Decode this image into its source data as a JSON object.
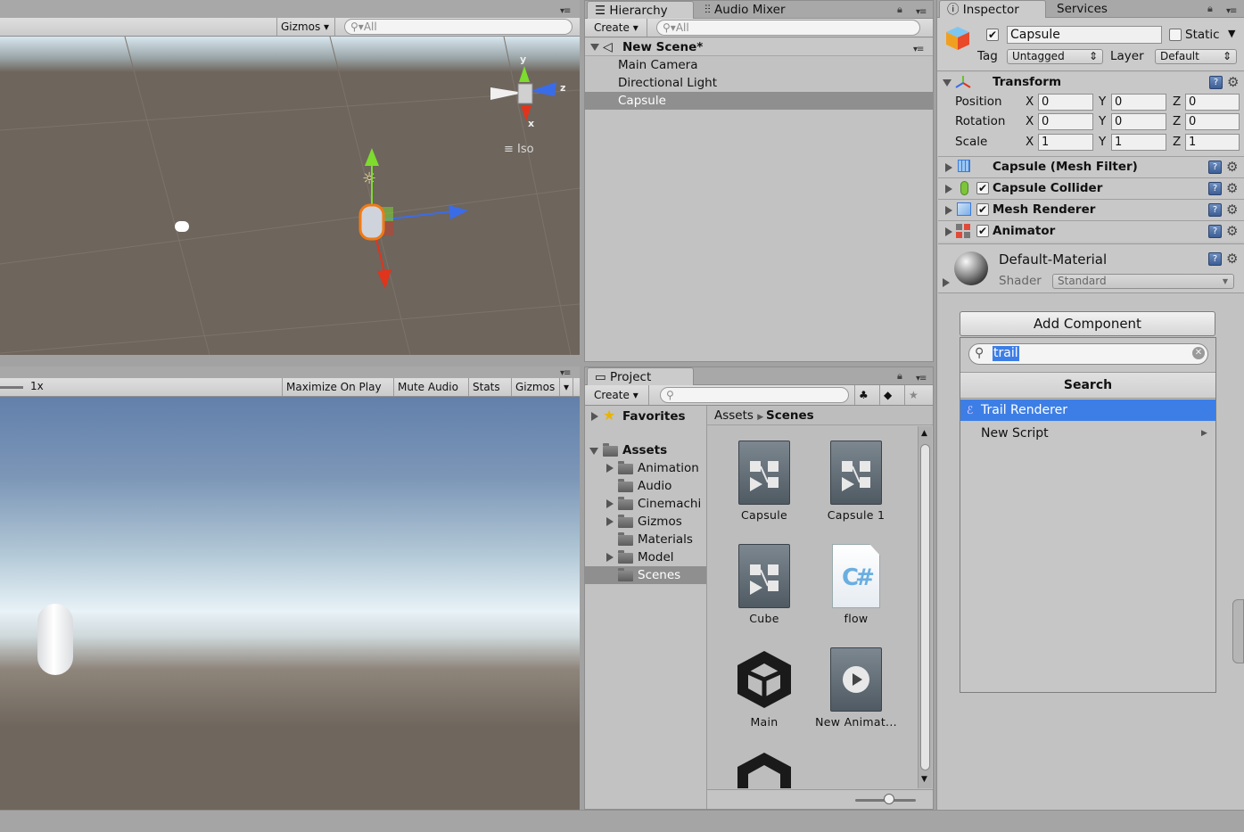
{
  "scene_view": {
    "gizmos_label": "Gizmos",
    "search_placeholder": "All",
    "iso_label": "Iso",
    "axis_y": "y",
    "axis_z": "z",
    "axis_x": "x"
  },
  "game_view": {
    "scale_label": "1x",
    "maximize_label": "Maximize On Play",
    "mute_label": "Mute Audio",
    "stats_label": "Stats",
    "gizmos_label": "Gizmos"
  },
  "hierarchy": {
    "tab_label": "Hierarchy",
    "tab2_label": "Audio Mixer",
    "create_label": "Create",
    "search_placeholder": "All",
    "scene_name": "New Scene*",
    "items": [
      {
        "label": "Main Camera"
      },
      {
        "label": "Directional Light"
      },
      {
        "label": "Capsule"
      }
    ]
  },
  "project": {
    "tab_label": "Project",
    "create_label": "Create",
    "favorites_label": "Favorites",
    "assets_label": "Assets",
    "folders": [
      {
        "label": "Animation"
      },
      {
        "label": "Audio"
      },
      {
        "label": "Cinemachi"
      },
      {
        "label": "Gizmos"
      },
      {
        "label": "Materials"
      },
      {
        "label": "Model"
      },
      {
        "label": "Scenes"
      }
    ],
    "breadcrumb_root": "Assets",
    "breadcrumb_current": "Scenes",
    "assets": [
      {
        "label": "Capsule",
        "kind": "prefab"
      },
      {
        "label": "Capsule 1",
        "kind": "prefab"
      },
      {
        "label": "Cube",
        "kind": "prefab"
      },
      {
        "label": "flow",
        "kind": "csharp-script"
      },
      {
        "label": "Main",
        "kind": "unity-scene"
      },
      {
        "label": "New Animat...",
        "kind": "animation"
      }
    ],
    "csharp_glyph": "C#"
  },
  "inspector": {
    "tab_label": "Inspector",
    "tab2_label": "Services",
    "object_name": "Capsule",
    "static_label": "Static",
    "tag_label": "Tag",
    "tag_value": "Untagged",
    "layer_label": "Layer",
    "layer_value": "Default",
    "transform": {
      "title": "Transform",
      "position_label": "Position",
      "rotation_label": "Rotation",
      "scale_label": "Scale",
      "x_label": "X",
      "y_label": "Y",
      "z_label": "Z",
      "position": {
        "x": "0",
        "y": "0",
        "z": "0"
      },
      "rotation": {
        "x": "0",
        "y": "0",
        "z": "0"
      },
      "scale": {
        "x": "1",
        "y": "1",
        "z": "1"
      }
    },
    "components": [
      {
        "label": "Capsule (Mesh Filter)"
      },
      {
        "label": "Capsule Collider"
      },
      {
        "label": "Mesh Renderer"
      },
      {
        "label": "Animator"
      }
    ],
    "material": {
      "name": "Default-Material",
      "shader_label": "Shader",
      "shader_value": "Standard"
    },
    "add_component_label": "Add Component",
    "add_component_popup": {
      "search_value": "trail",
      "header": "Search",
      "results": [
        {
          "label": "Trail Renderer"
        },
        {
          "label": "New Script"
        }
      ]
    }
  },
  "colors": {
    "selection_blue": "#3d7ee6",
    "hierarchy_selected": "#8f8f8f",
    "axis_red": "#e0341c",
    "axis_green": "#7ddc2e",
    "axis_blue": "#3b6ce8"
  }
}
